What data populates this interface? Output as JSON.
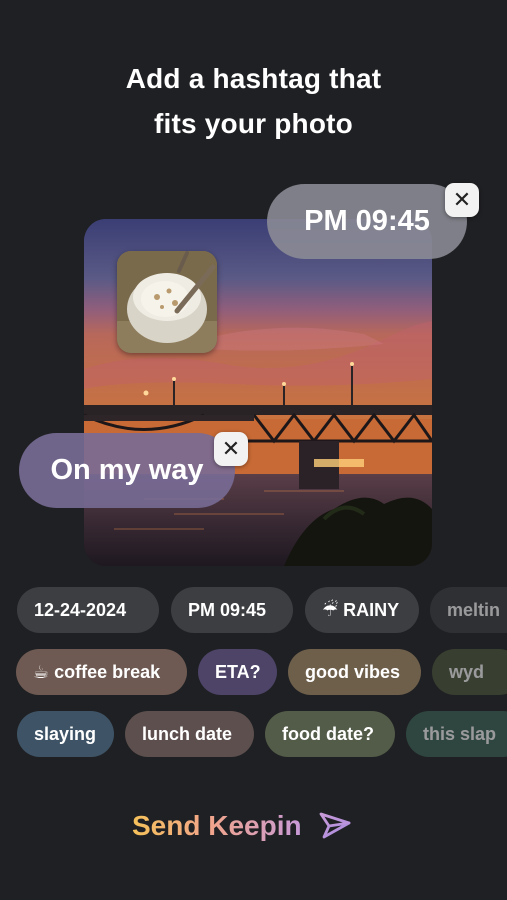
{
  "header": {
    "title_line1": "Add a hashtag that",
    "title_line2": "fits your photo"
  },
  "photo": {
    "stickers": {
      "time_sticker": "PM 09:45",
      "text_sticker": "On my way"
    },
    "remove_icon": "close-icon"
  },
  "hashtags": {
    "row1": [
      {
        "label": "12-24-2024",
        "color": "#3d3e41"
      },
      {
        "label": "PM 09:45",
        "color": "#3d3e41"
      },
      {
        "label": "☔ RAINY",
        "color": "#3d3e41"
      },
      {
        "label": "meltin",
        "color": "#3d3e41"
      }
    ],
    "row2": [
      {
        "label": "☕ coffee break",
        "color": "#6e5a52"
      },
      {
        "label": "ETA?",
        "color": "#4d4468"
      },
      {
        "label": "good vibes",
        "color": "#6e5f4b"
      },
      {
        "label": "wyd",
        "color": "#4d5a3c"
      }
    ],
    "row3": [
      {
        "label": "slaying",
        "color": "#3e5466"
      },
      {
        "label": "lunch date",
        "color": "#5c4f4d"
      },
      {
        "label": "food date?",
        "color": "#535c48"
      },
      {
        "label": "this slap",
        "color": "#3b6656"
      }
    ]
  },
  "footer": {
    "send_label": "Send Keepin",
    "send_icon": "paper-plane-icon",
    "accent_gradient": [
      "#f4c15a",
      "#f2a58a",
      "#c79ad8"
    ]
  }
}
